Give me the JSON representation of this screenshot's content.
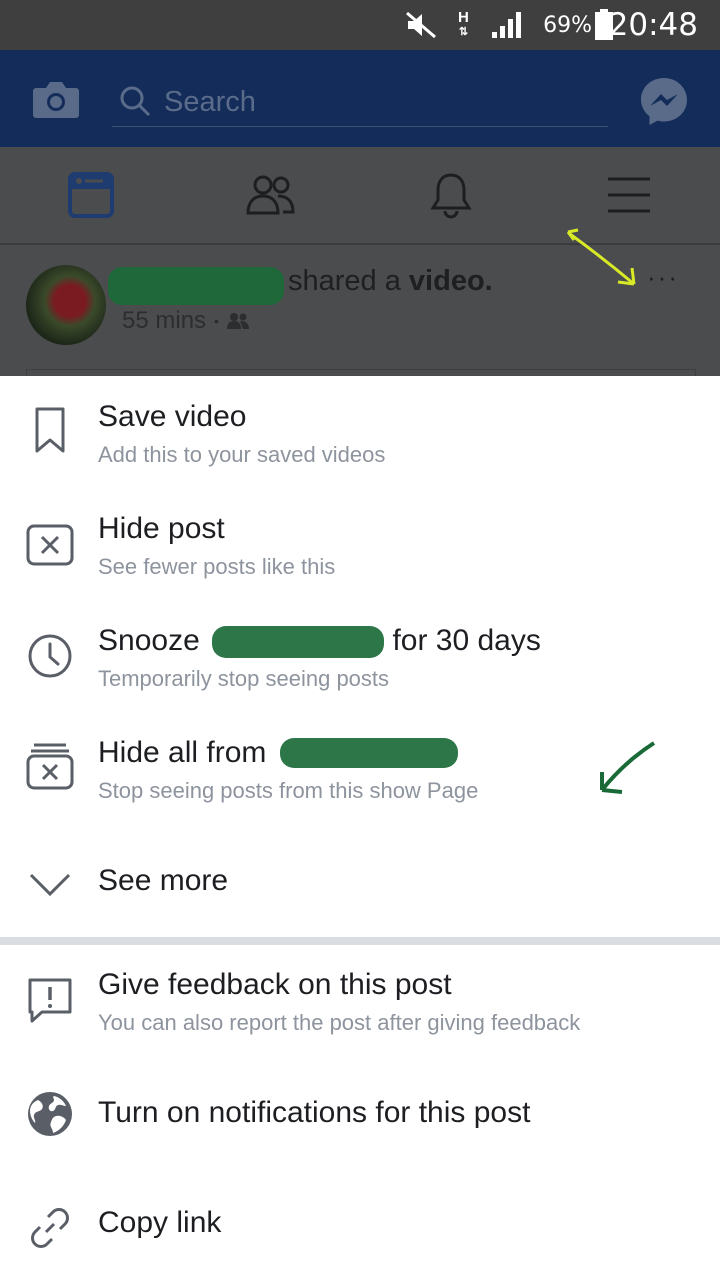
{
  "status_bar": {
    "battery_percent": "69%",
    "time": "20:48",
    "network_label": "H"
  },
  "topbar": {
    "search_placeholder": "Search"
  },
  "post": {
    "action_text": "shared a",
    "object_text": "video.",
    "time": "55 mins",
    "more_symbol": "···"
  },
  "menu": {
    "items": [
      {
        "title": "Save video",
        "subtitle": "Add this to your saved videos",
        "icon": "bookmark-icon"
      },
      {
        "title": "Hide post",
        "subtitle": "See fewer posts like this",
        "icon": "hide-post-icon"
      },
      {
        "title_prefix": "Snooze",
        "title_suffix": "for 30 days",
        "subtitle": "Temporarily stop seeing posts",
        "icon": "clock-icon"
      },
      {
        "title_prefix": "Hide all from",
        "subtitle": "Stop seeing posts from this show Page",
        "icon": "hide-all-icon"
      },
      {
        "title": "See more",
        "icon": "chevron-down-icon"
      },
      {
        "title": "Give feedback on this post",
        "subtitle": "You can also report the post after giving feedback",
        "icon": "feedback-icon"
      },
      {
        "title": "Turn on notifications for this post",
        "icon": "globe-icon"
      },
      {
        "title": "Copy link",
        "icon": "link-icon"
      }
    ]
  },
  "colors": {
    "header": "#132c59",
    "dim_overlay": "#4b4c4e",
    "annotation_yellow": "#d8ea26",
    "annotation_green": "#1a6a38"
  }
}
